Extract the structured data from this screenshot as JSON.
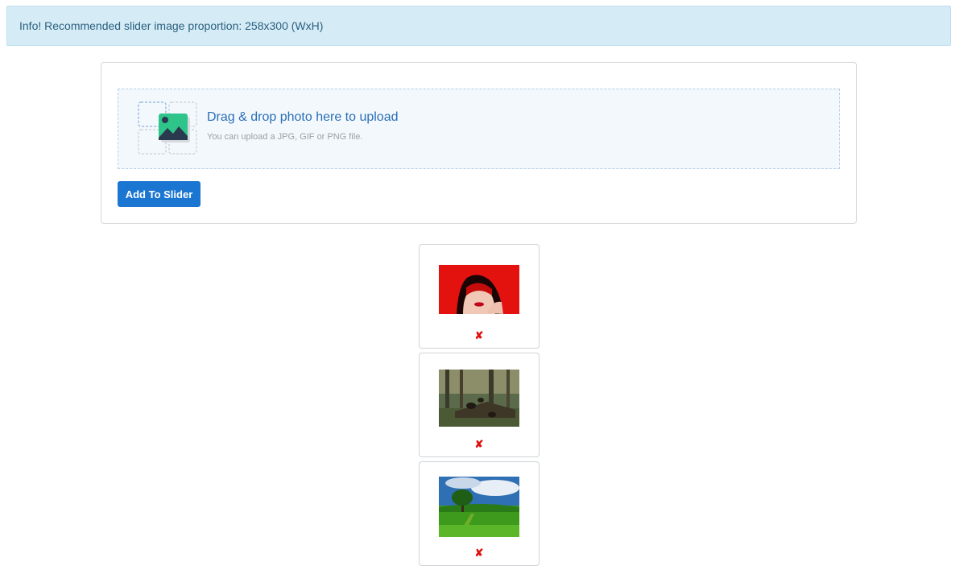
{
  "alert": {
    "text": "Info! Recommended slider image proportion: 258x300 (WxH)",
    "color": "#d5ecf6"
  },
  "upload": {
    "title": "Drag & drop photo here to upload",
    "subtitle": "You can upload a JPG, GIF or PNG file.",
    "icon": "image-upload-icon"
  },
  "actions": {
    "add_label": "Add To Slider",
    "accent": "#1b76d1"
  },
  "slides": [
    {
      "image": "woman-red-hood-photo",
      "remove_label": "✘"
    },
    {
      "image": "forest-bears-painting",
      "remove_label": "✘"
    },
    {
      "image": "green-field-tree-landscape",
      "remove_label": "✘"
    }
  ]
}
